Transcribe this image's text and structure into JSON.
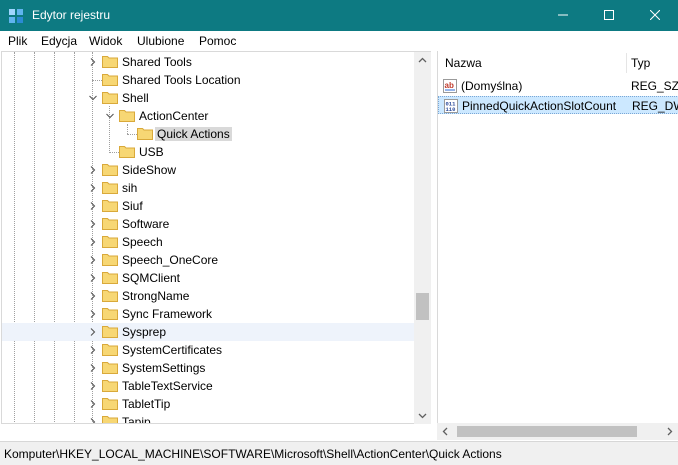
{
  "window": {
    "title": "Edytor rejestru",
    "minimize_icon": "minimize-icon",
    "maximize_icon": "maximize-icon",
    "close_icon": "close-icon"
  },
  "menu": [
    "Plik",
    "Edycja",
    "Widok",
    "Ulubione",
    "Pomoc"
  ],
  "tree": {
    "items": [
      {
        "label": "Shared Tools",
        "expander": "collapsed"
      },
      {
        "label": "Shared Tools Location",
        "expander": "none"
      },
      {
        "label": "Shell",
        "expander": "expanded"
      },
      {
        "label": "ActionCenter",
        "expander": "expanded"
      },
      {
        "label": "Quick Actions",
        "expander": "none",
        "selected": true
      },
      {
        "label": "USB",
        "expander": "none"
      },
      {
        "label": "SideShow",
        "expander": "collapsed"
      },
      {
        "label": "sih",
        "expander": "collapsed"
      },
      {
        "label": "Siuf",
        "expander": "collapsed"
      },
      {
        "label": "Software",
        "expander": "collapsed"
      },
      {
        "label": "Speech",
        "expander": "collapsed"
      },
      {
        "label": "Speech_OneCore",
        "expander": "collapsed"
      },
      {
        "label": "SQMClient",
        "expander": "collapsed"
      },
      {
        "label": "StrongName",
        "expander": "collapsed"
      },
      {
        "label": "Sync Framework",
        "expander": "collapsed"
      },
      {
        "label": "Sysprep",
        "expander": "collapsed"
      },
      {
        "label": "SystemCertificates",
        "expander": "collapsed"
      },
      {
        "label": "SystemSettings",
        "expander": "collapsed"
      },
      {
        "label": "TableTextService",
        "expander": "collapsed"
      },
      {
        "label": "TabletTip",
        "expander": "collapsed"
      },
      {
        "label": "Tapip",
        "expander": "collapsed"
      }
    ]
  },
  "list": {
    "columns": [
      "Nazwa",
      "Typ"
    ],
    "rows": [
      {
        "name": "(Domyślna)",
        "type": "REG_SZ",
        "icon": "string-value-icon",
        "selected": false
      },
      {
        "name": "PinnedQuickActionSlotCount",
        "type": "REG_DW",
        "icon": "binary-value-icon",
        "selected": true
      }
    ]
  },
  "status": {
    "path": "Komputer\\HKEY_LOCAL_MACHINE\\SOFTWARE\\Microsoft\\Shell\\ActionCenter\\Quick Actions"
  }
}
